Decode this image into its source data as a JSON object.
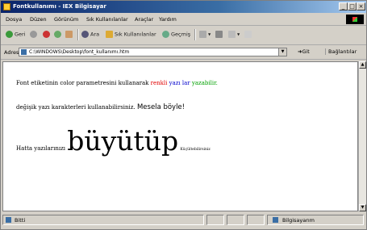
{
  "window": {
    "title": "Fontkullanımı - IEX Bilgisayar",
    "minimize": "_",
    "maximize": "□",
    "close": "×"
  },
  "menu": {
    "items": [
      "Dosya",
      "Düzen",
      "Görünüm",
      "Sık Kullanılanlar",
      "Araçlar",
      "Yardım"
    ]
  },
  "toolbar": {
    "back": "Geri",
    "search": "Ara",
    "favorites": "Sık Kullanılanlar",
    "history": "Geçmiş"
  },
  "address": {
    "label": "Adres",
    "value": "C:\\WINDOWS\\Desktop\\font_kullanımı.htm",
    "dropdown": "▼",
    "go": "Git",
    "links": "Bağlantılar"
  },
  "content": {
    "line1_prefix": "Font etiketinin color parametresini kullanarak",
    "word_red": "renkli",
    "word_blue": "yazı lar",
    "word_green": "yazabilir.",
    "line2_prefix": "değişik yazı karakterleri kullanabilirsiniz.",
    "line2_sans": "Mesela böyle!",
    "line3_prefix": "Hatta yazılarınızı",
    "line3_big": "büyütüp",
    "line3_small": "Küçültebilirsiniz"
  },
  "status": {
    "left": "Bitti",
    "zone": "Bilgisayarım"
  },
  "colors": {
    "title_start": "#0a246a",
    "red": "#e00000",
    "blue": "#0000cc",
    "green": "#00a000"
  }
}
